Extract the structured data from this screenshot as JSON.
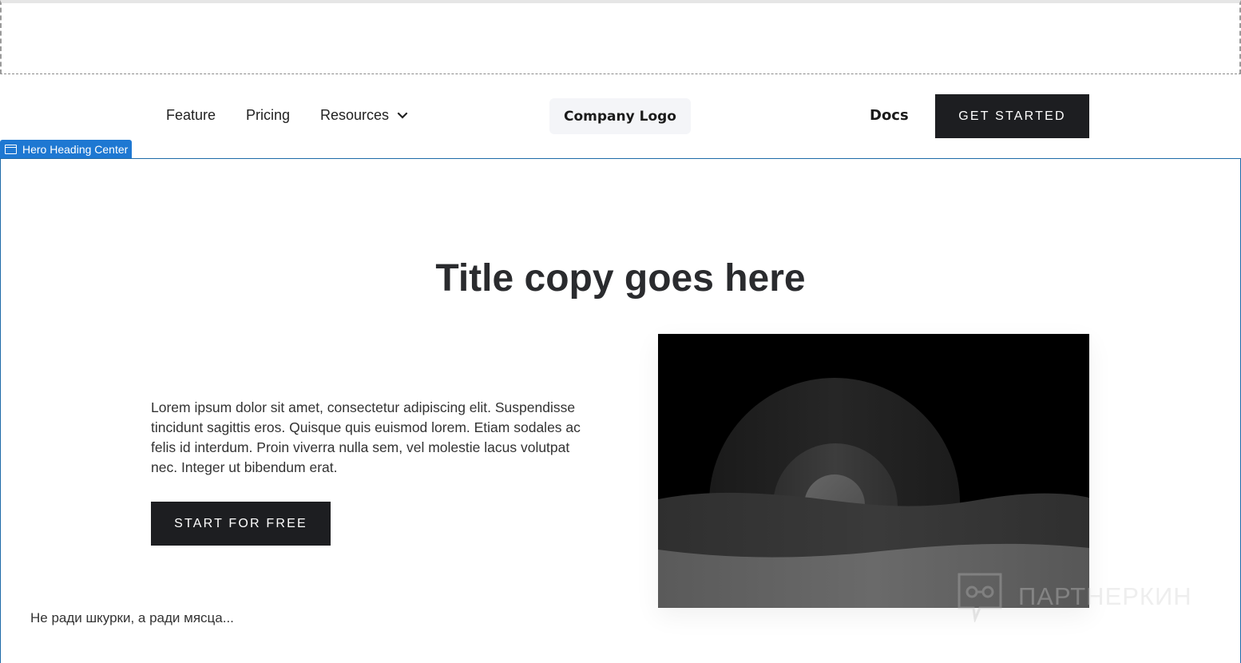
{
  "nav": {
    "feature": "Feature",
    "pricing": "Pricing",
    "resources": "Resources",
    "logo": "Company Logo",
    "docs": "Docs",
    "cta": "GET STARTED"
  },
  "editor": {
    "selected_block_label": "Hero Heading Center",
    "accent_color": "#1e78d2"
  },
  "hero": {
    "title": "Title copy goes here",
    "body": "Lorem ipsum dolor sit amet, consectetur adipiscing elit. Suspendisse tincidunt sagittis eros. Quisque quis euismod lorem. Etiam sodales ac felis id interdum. Proin viverra nulla sem, vel molestie lacus volutpat nec. Integer ut bibendum erat.",
    "cta": "START FOR FREE",
    "image_icon": "placeholder-landscape-image"
  },
  "footer_text": "Не ради шкурки, а ради мясца...",
  "watermark": {
    "text": "ПАРТНЕРКИН",
    "icon": "chat-bubble-glasses-icon"
  },
  "colors": {
    "button_bg": "#1d1e21",
    "logo_bg": "#f4f5f8",
    "hero_border": "#1e6aa8"
  }
}
